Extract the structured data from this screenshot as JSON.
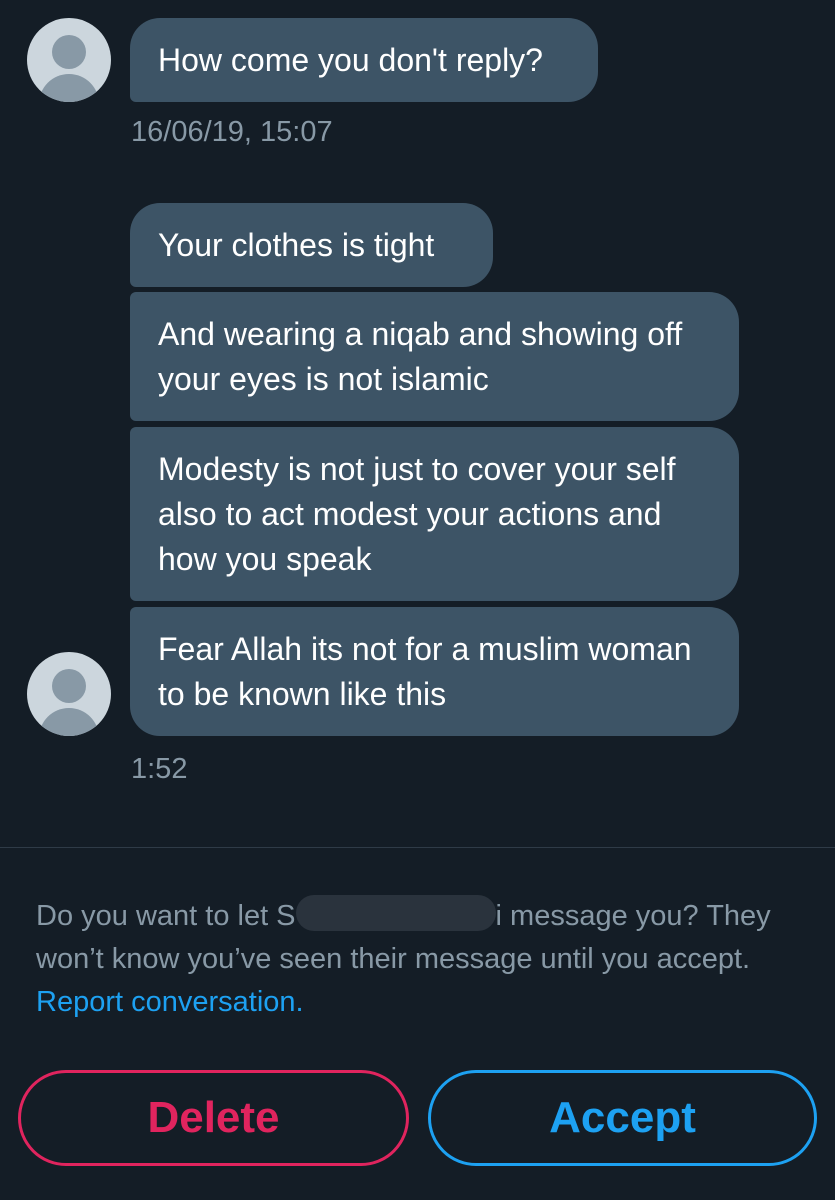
{
  "conversation": {
    "group1": {
      "messages": [
        "How come you don't reply?"
      ],
      "timestamp": "16/06/19, 15:07"
    },
    "group2": {
      "messages": [
        "Your clothes is tight",
        "And wearing a niqab and showing off your eyes is not islamic",
        "Modesty is not just to cover your self also to act modest your actions and how you speak",
        "Fear Allah its not for a muslim woman to be known like this"
      ],
      "timestamp": "1:52"
    }
  },
  "request": {
    "prompt_prefix": "Do you want to let S",
    "prompt_suffix": "i message you?",
    "info": " They won’t know you’ve seen their message until you accept. ",
    "report_link": "Report conversation."
  },
  "actions": {
    "delete_label": "Delete",
    "accept_label": "Accept"
  },
  "colors": {
    "background": "#141d26",
    "bubble": "#3d5466",
    "secondary_text": "#8899a6",
    "link": "#1da1f2",
    "delete": "#e0245e",
    "accept": "#1da1f2"
  }
}
